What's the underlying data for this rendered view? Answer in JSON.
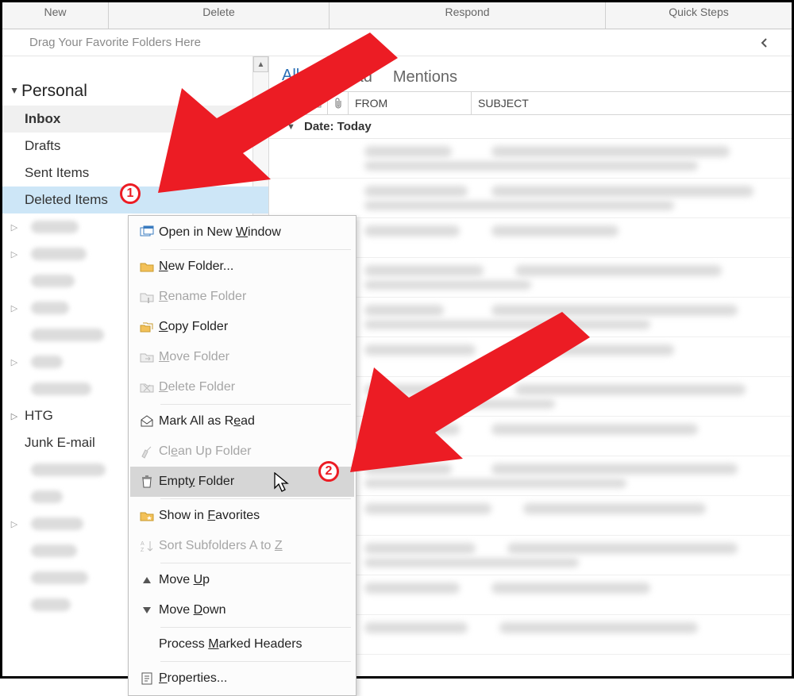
{
  "ribbon": {
    "new": "New",
    "delete": "Delete",
    "respond": "Respond",
    "quick": "Quick Steps"
  },
  "favorites_hint": "Drag Your Favorite Folders Here",
  "tree": {
    "root": "Personal",
    "inbox": "Inbox",
    "drafts": "Drafts",
    "sent": "Sent Items",
    "deleted": "Deleted Items",
    "htg": "HTG",
    "junk": "Junk E-mail"
  },
  "tabs": {
    "all": "All",
    "unread": "Unread",
    "mentions": "Mentions"
  },
  "cols": {
    "from": "FROM",
    "subject": "SUBJECT"
  },
  "group_today": "Date:  Today",
  "menu": {
    "open": "Open in New Window",
    "newf": "New Folder...",
    "rename": "Rename Folder",
    "copy": "Copy Folder",
    "move": "Move Folder",
    "del": "Delete Folder",
    "mark": "Mark All as Read",
    "clean": "Clean Up Folder",
    "empty": "Empty Folder",
    "fav": "Show in Favorites",
    "sort": "Sort Subfolders A to Z",
    "moveup": "Move Up",
    "movedown": "Move Down",
    "headers": "Process Marked Headers",
    "props": "Properties...",
    "u": {
      "open": "W",
      "newf": "N",
      "rename": "R",
      "copy": "C",
      "move": "M",
      "del": "D",
      "mark": "e",
      "clean": "e",
      "empty": "y",
      "fav": "F",
      "sort": "Z",
      "moveup": "U",
      "movedown": "D",
      "headers": "M",
      "props": "P"
    }
  },
  "badges": {
    "b1": "1",
    "b2": "2"
  }
}
